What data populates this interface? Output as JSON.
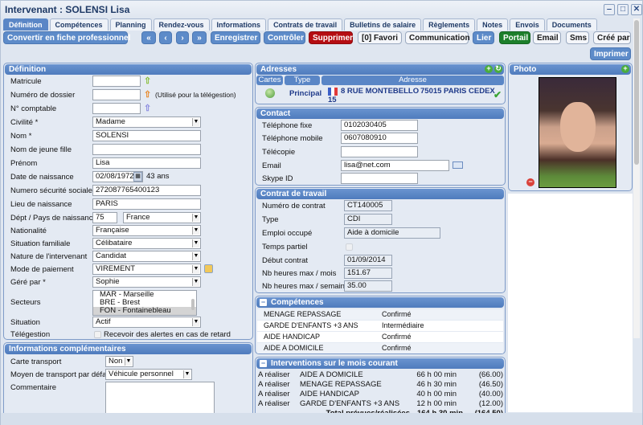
{
  "window": {
    "title": "Intervenant : SOLENSI Lisa",
    "controls": {
      "minimize": "‒",
      "maximize": "□",
      "close": "✕"
    }
  },
  "tabs": [
    {
      "label": "Définition",
      "active": true
    },
    {
      "label": "Compétences",
      "active": false
    },
    {
      "label": "Planning",
      "active": false
    },
    {
      "label": "Rendez-vous",
      "active": false
    },
    {
      "label": "Informations",
      "active": false
    },
    {
      "label": "Contrats de travail",
      "active": false
    },
    {
      "label": "Bulletins de salaire",
      "active": false
    },
    {
      "label": "Règlements",
      "active": false
    },
    {
      "label": "Notes",
      "active": false
    },
    {
      "label": "Envois",
      "active": false
    },
    {
      "label": "Documents",
      "active": false
    }
  ],
  "toolbar": {
    "convert": "Convertir en fiche professionnel",
    "first": "«",
    "prev": "‹",
    "next": "›",
    "last": "»",
    "save": "Enregistrer",
    "check": "Contrôler",
    "delete": "Supprimer",
    "favorite": "[0] Favori",
    "communication": "Communication",
    "link": "Lier",
    "portal": "Portail",
    "email": "Email",
    "sms": "Sms",
    "created_by": "Créé par",
    "print": "Imprimer"
  },
  "definition": {
    "title": "Définition",
    "matricule": {
      "label": "Matricule",
      "value": ""
    },
    "dossier": {
      "label": "Numéro de dossier",
      "value": "",
      "note": "(Utilisé pour la télégestion)"
    },
    "comptable": {
      "label": "N° comptable",
      "value": ""
    },
    "civilite": {
      "label": "Civilité *",
      "value": "Madame"
    },
    "nom": {
      "label": "Nom *",
      "value": "SOLENSI"
    },
    "nom_jeune_fille": {
      "label": "Nom de jeune fille",
      "value": ""
    },
    "prenom": {
      "label": "Prénom",
      "value": "Lisa"
    },
    "naissance": {
      "label": "Date de naissance",
      "value": "02/08/1972",
      "age": "43 ans"
    },
    "secu": {
      "label": "Numero sécurité sociale",
      "value": "272087765400123"
    },
    "lieu": {
      "label": "Lieu de naissance",
      "value": "PARIS"
    },
    "dept_pays": {
      "label": "Dépt / Pays de naissance",
      "dept": "75",
      "pays": "France"
    },
    "nationalite": {
      "label": "Nationalité",
      "value": "Française"
    },
    "situation_familiale": {
      "label": "Situation familiale",
      "value": "Célibataire"
    },
    "nature": {
      "label": "Nature de l'intervenant",
      "value": "Candidat"
    },
    "paiement": {
      "label": "Mode de paiement",
      "value": "VIREMENT"
    },
    "gere_par": {
      "label": "Géré par *",
      "value": "Sophie"
    },
    "secteurs": {
      "label": "Secteurs",
      "options": [
        "MAR - Marseille",
        "BRE - Brest",
        "FON - Fontainebleau"
      ],
      "selected": "FON - Fontainebleau"
    },
    "situation": {
      "label": "Situation",
      "value": "Actif"
    },
    "telegestion": {
      "label": "Télégestion",
      "checkbox_label": "Recevoir des alertes en cas de retard",
      "checked": false
    }
  },
  "info_comp": {
    "title": "Informations complémentaires",
    "carte": {
      "label": "Carte transport",
      "value": "Non"
    },
    "transport": {
      "label": "Moyen de transport par défaut",
      "value": "Véhicule personnel"
    },
    "commentaire": {
      "label": "Commentaire",
      "value": ""
    }
  },
  "adresses": {
    "title": "Adresses",
    "columns": [
      "Cartes",
      "Type",
      "Adresse"
    ],
    "row": {
      "type": "Principal",
      "address": "8 RUE MONTEBELLO",
      "city": "75015 PARIS CEDEX",
      "extra": "15"
    }
  },
  "contact": {
    "title": "Contact",
    "fixe": {
      "label": "Téléphone fixe",
      "value": "0102030405"
    },
    "mobile": {
      "label": "Téléphone mobile",
      "value": "0607080910"
    },
    "fax": {
      "label": "Télécopie",
      "value": ""
    },
    "email": {
      "label": "Email",
      "value": "lisa@net.com"
    },
    "skype": {
      "label": "Skype ID",
      "value": ""
    }
  },
  "contrat": {
    "title": "Contrat de travail",
    "numero": {
      "label": "Numéro de contrat",
      "value": "CT140005"
    },
    "type": {
      "label": "Type",
      "value": "CDI"
    },
    "emploi": {
      "label": "Emploi occupé",
      "value": "Aide à domicile"
    },
    "partiel": {
      "label": "Temps partiel",
      "checked": false
    },
    "debut": {
      "label": "Début contrat",
      "value": "01/09/2014"
    },
    "mois": {
      "label": "Nb heures max / mois",
      "value": "151.67"
    },
    "semaine": {
      "label": "Nb heures max / semaine",
      "value": "35.00"
    }
  },
  "competences": {
    "title": "Compétences",
    "rows": [
      {
        "name": "MENAGE REPASSAGE",
        "level": "Confirmé"
      },
      {
        "name": "GARDE D'ENFANTS +3 ANS",
        "level": "Intermédiaire"
      },
      {
        "name": "AIDE HANDICAP",
        "level": "Confirmé"
      },
      {
        "name": "AIDE A DOMICILE",
        "level": "Confirmé"
      }
    ]
  },
  "interventions": {
    "title": "Interventions sur le mois courant",
    "rows": [
      {
        "status": "A réaliser",
        "name": "AIDE A DOMICILE",
        "duration": "66 h 00 min",
        "decimal": "(66.00)"
      },
      {
        "status": "A réaliser",
        "name": "MENAGE REPASSAGE",
        "duration": "46 h 30 min",
        "decimal": "(46.50)"
      },
      {
        "status": "A réaliser",
        "name": "AIDE HANDICAP",
        "duration": "40 h 00 min",
        "decimal": "(40.00)"
      },
      {
        "status": "A réaliser",
        "name": "GARDE D'ENFANTS +3 ANS",
        "duration": "12 h 00 min",
        "decimal": "(12.00)"
      }
    ],
    "total": {
      "label": "Total prévues/réalisées",
      "duration": "164 h 30 min",
      "decimal": "(164.50)"
    }
  },
  "photo": {
    "title": "Photo"
  }
}
